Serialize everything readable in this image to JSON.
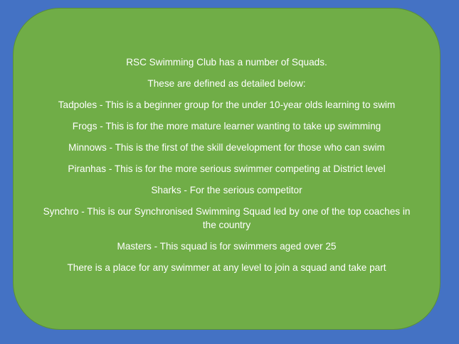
{
  "colors": {
    "background": "#4472c4",
    "panel": "#70ad47",
    "text": "#ffffff"
  },
  "panel": {
    "lines": [
      "RSC Swimming Club has a number of Squads.",
      "These are defined as detailed below:",
      "Tadpoles - This is a beginner group for the under 10-year olds learning to swim",
      "Frogs - This is for the more mature learner wanting to take up swimming",
      "Minnows - This is the first of the skill development for those who can swim",
      "Piranhas - This is for the more serious swimmer competing at District level",
      "Sharks - For the serious competitor",
      "Synchro - This is our Synchronised Swimming Squad led by one of the top coaches in the country",
      "Masters - This squad is for swimmers aged over 25",
      "There is a place for any swimmer at any level to join a squad and take part"
    ]
  }
}
